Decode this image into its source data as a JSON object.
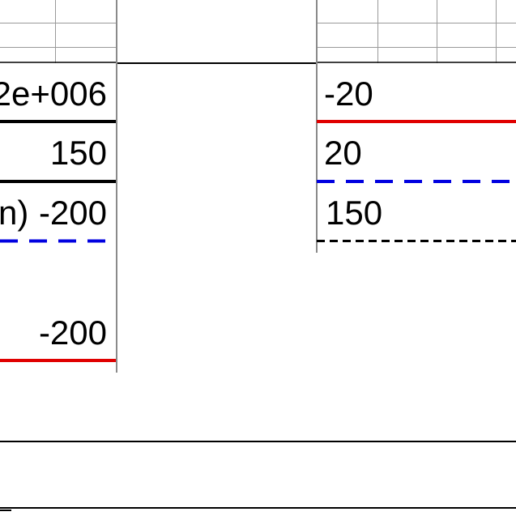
{
  "table_left": {
    "rows": [
      {
        "label": "",
        "value": "2e+006"
      },
      {
        "label": "",
        "value": "150"
      },
      {
        "label": "n)",
        "value": "-200"
      },
      {
        "label": "",
        "value": "-200"
      }
    ]
  },
  "table_right": {
    "rows": [
      {
        "value": "-20"
      },
      {
        "value": "20"
      },
      {
        "value": "150"
      }
    ]
  },
  "colors": {
    "black_line": "#000000",
    "red_line": "#e00000",
    "blue_dash": "#0000e0",
    "grid_line": "#8a8a8a"
  }
}
